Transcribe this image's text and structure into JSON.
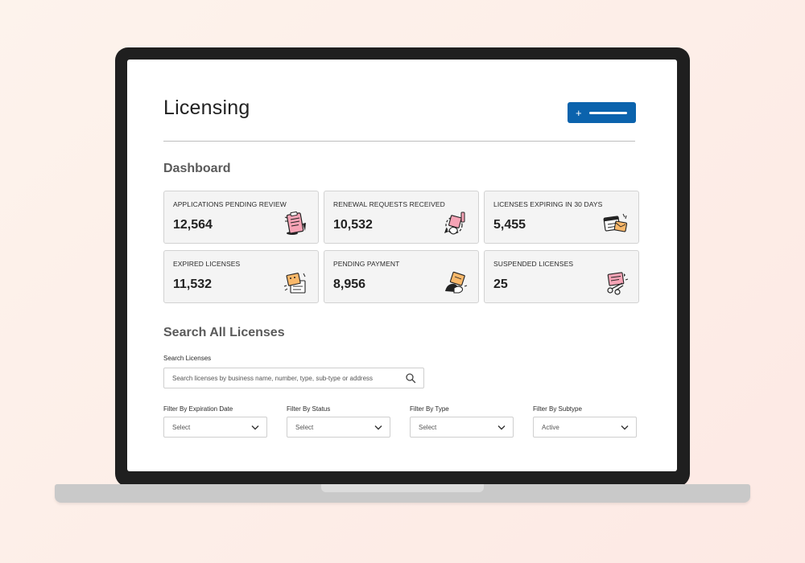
{
  "header": {
    "title": "Licensing",
    "add_button_symbol": "+"
  },
  "dashboard": {
    "title": "Dashboard",
    "cards": [
      {
        "label": "APPLICATIONS PENDING REVIEW",
        "value": "12,564",
        "icon": "clipboard-icon"
      },
      {
        "label": "RENEWAL REQUESTS RECEIVED",
        "value": "10,532",
        "icon": "renewal-icon"
      },
      {
        "label": "LICENSES EXPIRING IN 30 DAYS",
        "value": "5,455",
        "icon": "calendar-icon"
      },
      {
        "label": "EXPIRED LICENSES",
        "value": "11,532",
        "icon": "expired-license-icon"
      },
      {
        "label": "PENDING PAYMENT",
        "value": "8,956",
        "icon": "payment-icon"
      },
      {
        "label": "SUSPENDED LICENSES",
        "value": "25",
        "icon": "suspended-license-icon"
      }
    ]
  },
  "search": {
    "title": "Search All Licenses",
    "label": "Search Licenses",
    "placeholder": "Search licenses by business name, number, type, sub-type or address"
  },
  "filters": [
    {
      "label": "Filter By Expiration Date",
      "value": "Select"
    },
    {
      "label": "Filter By Status",
      "value": "Select"
    },
    {
      "label": "Filter By Type",
      "value": "Select"
    },
    {
      "label": "Filter By Subtype",
      "value": "Active"
    }
  ],
  "colors": {
    "accent": "#0b63ad",
    "card_bg": "#f4f4f4",
    "icon_pink": "#f5a3b5",
    "icon_orange": "#f9b86a"
  }
}
